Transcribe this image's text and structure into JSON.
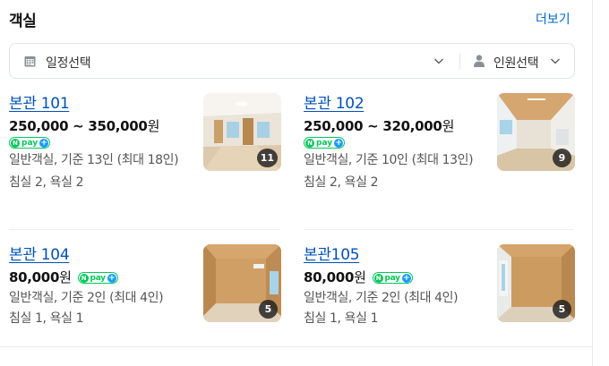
{
  "header": {
    "title": "객실",
    "more_label": "더보기"
  },
  "filters": {
    "date_label": "일정선택",
    "guest_label": "인원선택",
    "calendar_icon": "calendar-icon",
    "person_icon": "person-icon",
    "chevron_icon": "chevron-down-icon"
  },
  "npay": {
    "text": "pay",
    "n": "N",
    "plus": "+"
  },
  "rooms": [
    {
      "name": "본관 101",
      "price": "250,000 ~ 350,000",
      "currency": "원",
      "desc": "일반객실, 기준 13인 (최대 18인)",
      "beds": "침실 2, 욕실 2",
      "photo_count": "11"
    },
    {
      "name": "본관 102",
      "price": "250,000 ~ 320,000",
      "currency": "원",
      "desc": "일반객실, 기준 10인 (최대 13인)",
      "beds": "침실 2, 욕실 2",
      "photo_count": "9"
    },
    {
      "name": "본관 104",
      "price": "80,000",
      "currency": "원",
      "desc": "일반객실, 기준 2인 (최대 4인)",
      "beds": "침실 1, 욕실 1",
      "photo_count": "5"
    },
    {
      "name": "본관105",
      "price": "80,000",
      "currency": "원",
      "desc": "일반객실, 기준 2인 (최대 4인)",
      "beds": "침실 1, 욕실 1",
      "photo_count": "5"
    }
  ],
  "colors": {
    "link": "#0050b7",
    "more": "#0068c3",
    "npay_green": "#03c75a",
    "npay_plus": "#1a9bff"
  }
}
